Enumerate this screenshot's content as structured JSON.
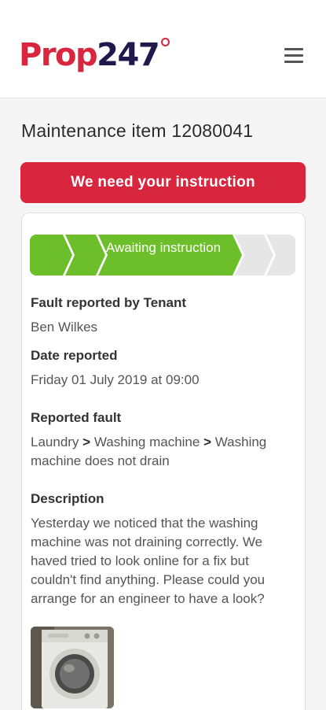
{
  "header": {
    "logo_main": "Prop",
    "logo_num": "247",
    "menu_icon": "hamburger-menu-icon"
  },
  "page": {
    "title": "Maintenance item 12080041"
  },
  "alert": {
    "label": "We need your instruction",
    "color": "#d7263d"
  },
  "progress": {
    "current_label": "Awaiting instruction",
    "steps_completed": 2,
    "current_step": 3,
    "total_steps": 5,
    "active_color": "#6cbf2a",
    "inactive_color": "#e6e6e6"
  },
  "details": {
    "reporter_label": "Fault reported by Tenant",
    "reporter_value": "Ben Wilkes",
    "date_label": "Date reported",
    "date_value": "Friday 01 July 2019 at 09:00",
    "fault_label": "Reported fault",
    "fault_path": [
      "Laundry",
      "Washing machine",
      "Washing machine does not drain"
    ],
    "fault_separator": ">",
    "description_label": "Description",
    "description_value": "Yesterday we noticed that the washing machine was not draining correctly. We haved tried to look online for a fix but couldn't find anything. Please could you arrange for an engineer to have a look?"
  },
  "attachments": {
    "photo_icon": "washing-machine-photo"
  }
}
